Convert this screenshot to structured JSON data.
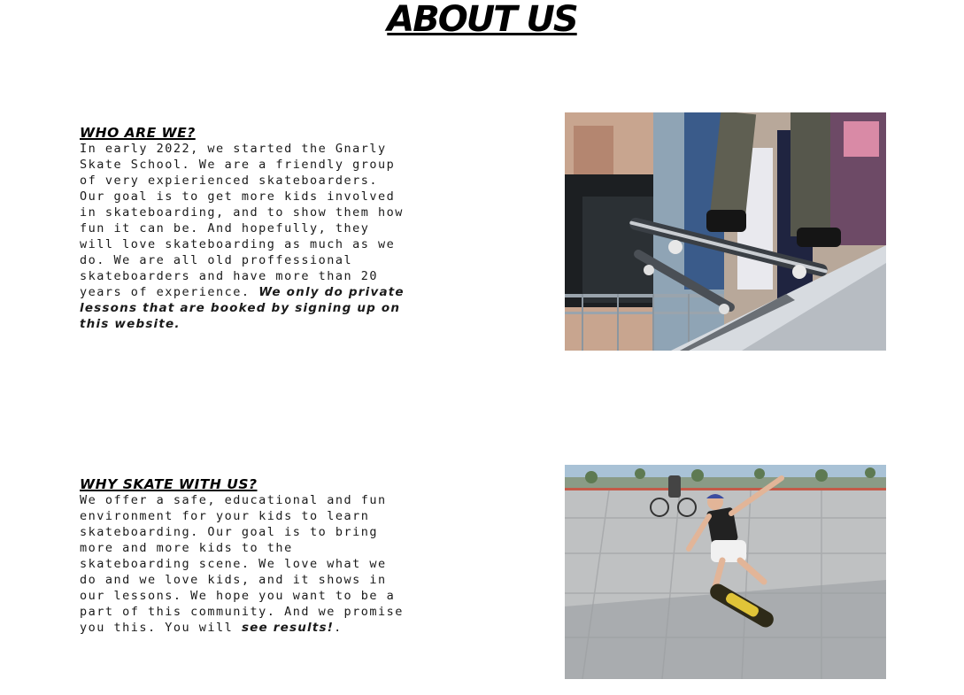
{
  "page": {
    "title": "About Us"
  },
  "sections": [
    {
      "heading": "Who are we?",
      "body": "In early 2022, we started the Gnarly Skate School. We are a friendly group of very expierienced skateboarders. Our goal is to get more kids involved in skateboarding, and to show them how fun it can be. And hopefully, they will love skateboarding as much as we do. We are all old proffessional skateboarders and have more than 20 years of experience. ",
      "emphasis": "We only do private lessons that are booked by signing up on this website.",
      "trailing": "",
      "image_icon": "skateboarders-on-ramp-photo"
    },
    {
      "heading": "Why skate with us?",
      "body": "We offer a safe, educational and fun environment for your kids to learn skateboarding. Our goal is to bring more and more kids to the skateboarding scene. We love what we do and we love kids, and it shows in our lessons. We hope you want to be a part of this community. And we promise you this. You will ",
      "emphasis": "see results!",
      "trailing": ".",
      "image_icon": "kid-kickflip-photo"
    }
  ],
  "colors": {
    "text": "#111111",
    "background": "#ffffff"
  }
}
